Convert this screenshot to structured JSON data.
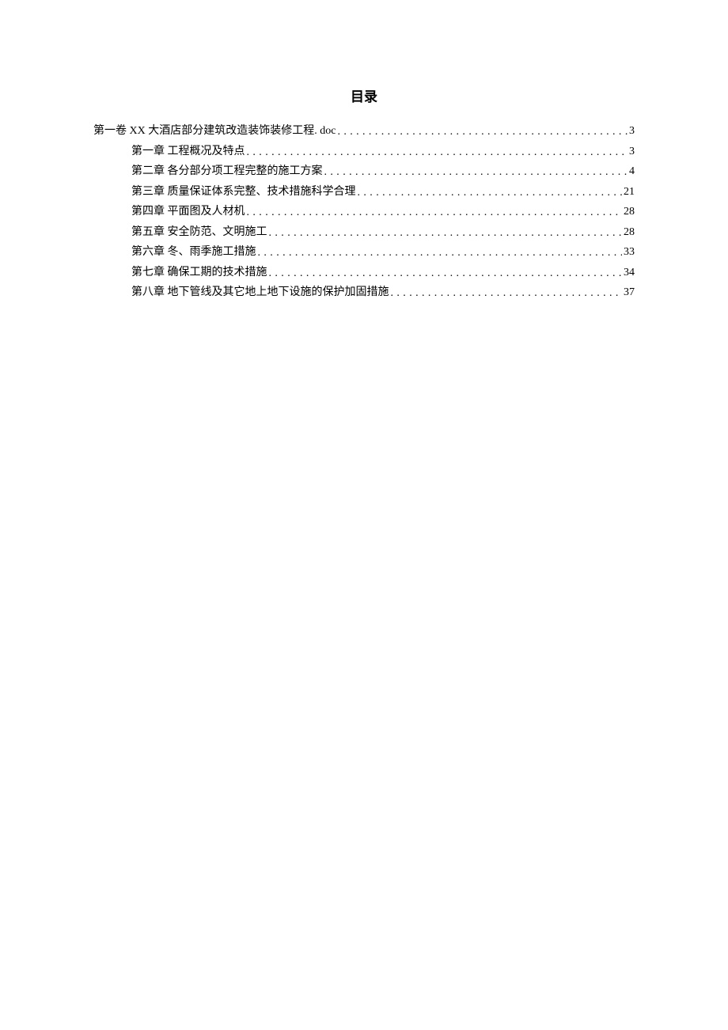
{
  "title": "目录",
  "toc": {
    "volume": {
      "label": "第一卷 XX 大酒店部分建筑改造装饰装修工程. doc",
      "page": "3"
    },
    "chapters": [
      {
        "label": "第一章 工程概况及特点",
        "page": "3"
      },
      {
        "label": "第二章 各分部分项工程完整的施工方案",
        "page": "4"
      },
      {
        "label": "第三章 质量保证体系完整、技术措施科学合理",
        "page": "21"
      },
      {
        "label": "第四章 平面图及人材机",
        "page": "28"
      },
      {
        "label": "第五章 安全防范、文明施工",
        "page": "28"
      },
      {
        "label": "第六章 冬、雨季施工措施",
        "page": "33"
      },
      {
        "label": "第七章 确保工期的技术措施",
        "page": "34"
      },
      {
        "label": "第八章 地下管线及其它地上地下设施的保护加固措施",
        "page": "37"
      }
    ]
  }
}
